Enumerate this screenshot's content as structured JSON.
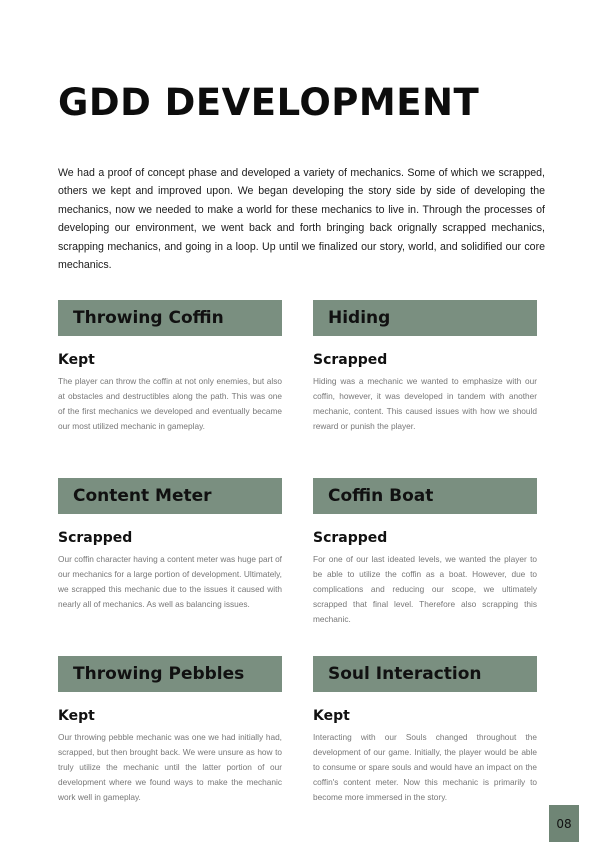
{
  "title": "GDD DEVELOPMENT",
  "intro": "We had a proof of concept phase and developed a variety of mechanics. Some of which we scrapped, others we kept and improved upon. We began developing the story side by side of developing the mechanics, now we needed to make a world for these mechanics to live in. Through the processes of developing our environment, we went back and forth bringing back orignally scrapped mechanics, scrapping mechanics, and going in a loop. Up until we finalized our story, world, and solidified our core mechanics.",
  "mechanics": [
    {
      "title": "Throwing Coffin",
      "status": "Kept",
      "text": "The player can throw the coffin at not only enemies, but also at obstacles and destructibles along the path. This was one of the first mechanics we developed and eventually became our most utilized mechanic in gameplay."
    },
    {
      "title": "Hiding",
      "status": "Scrapped",
      "text": "Hiding was a mechanic we wanted to emphasize with our coffin, however, it was developed in tandem with another mechanic, content. This caused issues with how we should reward or punish the player."
    },
    {
      "title": "Content Meter",
      "status": "Scrapped",
      "text": "Our coffin character having a content meter was huge part of our mechanics for a large portion of development. Ultimately, we scrapped this mechanic due to the issues it caused with nearly all of mechanics. As well as balancing issues."
    },
    {
      "title": "Coffin Boat",
      "status": "Scrapped",
      "text": "For one of our last ideated levels, we wanted the player to be able to utilize the coffin as a boat. However, due to complications and reducing our scope, we ultimately scrapped that final level. Therefore also scrapping this mechanic."
    },
    {
      "title": "Throwing Pebbles",
      "status": "Kept",
      "text": "Our throwing pebble mechanic was one we had initially had, scrapped, but then brought back. We were unsure as how to truly utilize the mechanic until the latter portion of our development where we found ways to make the mechanic work well in gameplay."
    },
    {
      "title": "Soul Interaction",
      "status": "Kept",
      "text": "Interacting with our Souls changed throughout the development of our game. Initially, the player would be able to consume or spare souls and would have an impact on the coffin's content meter. Now this mechanic is primarily to become more immersed in the story."
    }
  ],
  "page_number": "08",
  "colors": {
    "header_bg": "#7a8f80",
    "page_number_bg": "#6f8575",
    "body_text": "#777777"
  }
}
